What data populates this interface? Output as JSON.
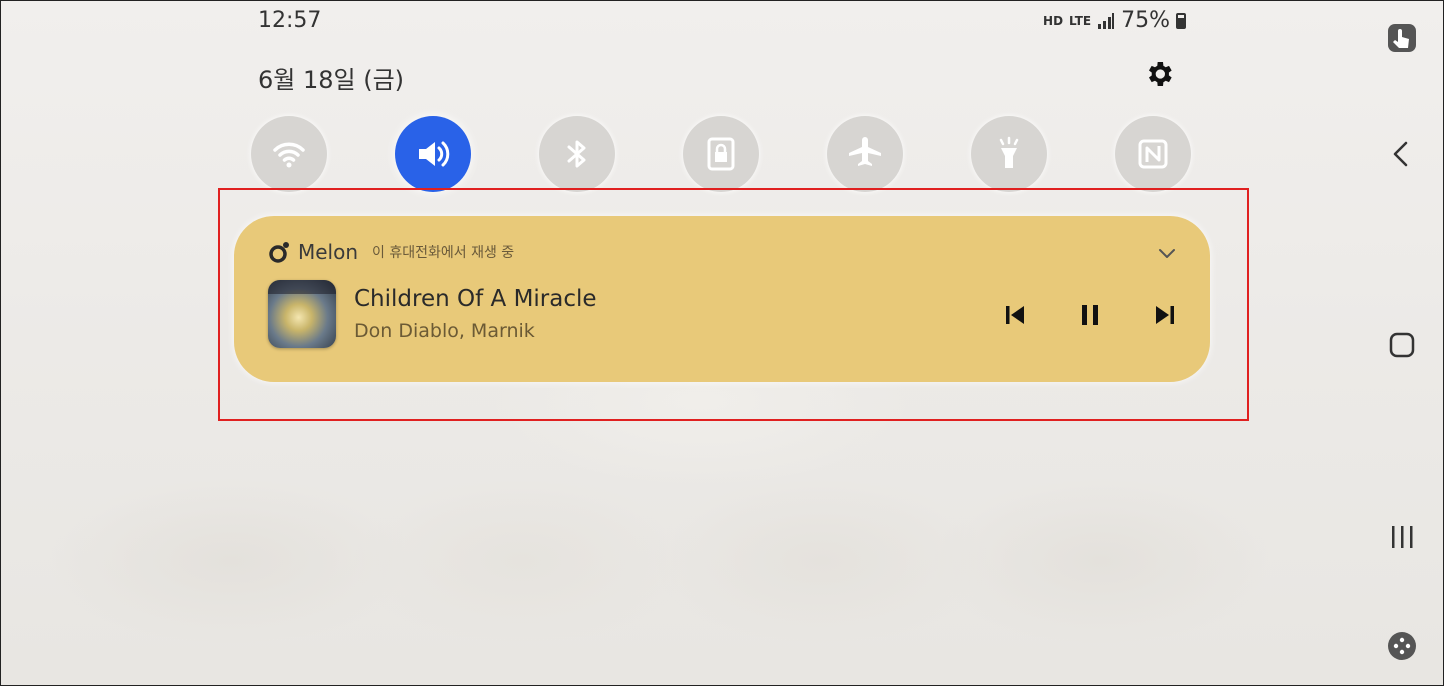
{
  "status_bar": {
    "time": "12:57",
    "hd_label": "HD",
    "network": "LTE",
    "battery": "75%"
  },
  "date": "6월 18일 (금)",
  "quick_toggles": [
    {
      "name": "wifi-toggle",
      "icon": "wifi-icon",
      "active": false
    },
    {
      "name": "sound-toggle",
      "icon": "speaker-icon",
      "active": true
    },
    {
      "name": "bluetooth-toggle",
      "icon": "bluetooth-icon",
      "active": false
    },
    {
      "name": "screen-lock-toggle",
      "icon": "lock-icon",
      "active": false
    },
    {
      "name": "airplane-toggle",
      "icon": "airplane-icon",
      "active": false
    },
    {
      "name": "flashlight-toggle",
      "icon": "flashlight-icon",
      "active": false
    },
    {
      "name": "nfc-toggle",
      "icon": "nfc-icon",
      "active": false
    }
  ],
  "media": {
    "app_name": "Melon",
    "playback_location": "이 휴대전화에서 재생 중",
    "title": "Children Of A Miracle",
    "artist": "Don Diablo, Marnik",
    "card_color": "#e8c979"
  },
  "colors": {
    "active_toggle": "#2962e8",
    "highlight_border": "#e02020"
  }
}
